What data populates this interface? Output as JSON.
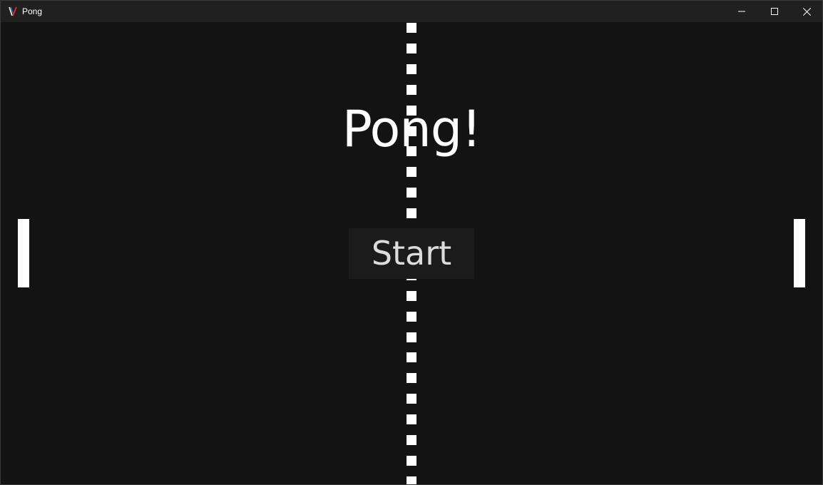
{
  "window": {
    "title": "Pong",
    "icon": "godot-app-icon",
    "controls": {
      "minimize_icon": "minimize-icon",
      "maximize_icon": "maximize-icon",
      "close_icon": "close-icon"
    }
  },
  "game": {
    "title": "Pong!",
    "start_label": "Start",
    "colors": {
      "background": "#131313",
      "foreground": "#ffffff",
      "button_bg": "#1b1b1b",
      "button_text": "#dcdcdc"
    }
  }
}
